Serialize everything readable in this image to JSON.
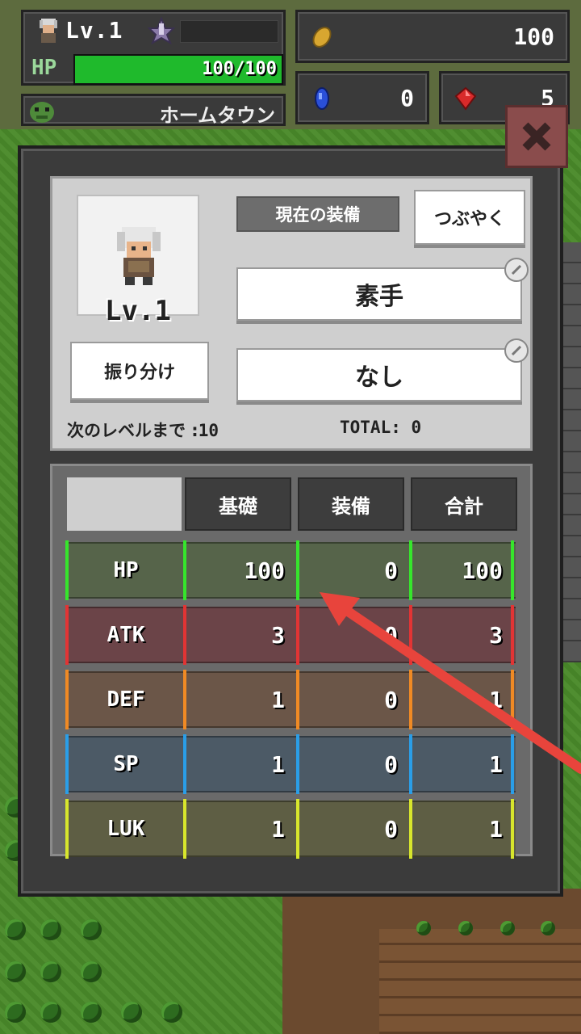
{
  "hud": {
    "level": "Lv.1",
    "hp_label": "HP",
    "hp_text": "100/100",
    "hp_fraction": 1.0,
    "location": "ホームタウン",
    "gold": "100",
    "blue_gems": "0",
    "red_gems": "5"
  },
  "dialog": {
    "portrait_level": "Lv.1",
    "current_equipment_label": "現在の装備",
    "whisper_button": "つぶやく",
    "weapon": "素手",
    "armor": "なし",
    "allocate_button": "振り分け",
    "next_level_label": "次のレベルまで :",
    "next_level_value": "10",
    "total_label": "TOTAL: ",
    "total_value": "0"
  },
  "stats": {
    "headers": [
      "基礎",
      "装備",
      "合計"
    ],
    "rows": [
      {
        "name": "HP",
        "base": "100",
        "equip": "0",
        "total": "100",
        "color": "#56644a",
        "accent": "#36e62c"
      },
      {
        "name": "ATK",
        "base": "3",
        "equip": "0",
        "total": "3",
        "color": "#6b4448",
        "accent": "#e23434"
      },
      {
        "name": "DEF",
        "base": "1",
        "equip": "0",
        "total": "1",
        "color": "#6b5648",
        "accent": "#f08a24"
      },
      {
        "name": "SP",
        "base": "1",
        "equip": "0",
        "total": "1",
        "color": "#4c5a66",
        "accent": "#2a9ee8"
      },
      {
        "name": "LUK",
        "base": "1",
        "equip": "0",
        "total": "1",
        "color": "#5e5e44",
        "accent": "#d8e62c"
      }
    ]
  },
  "colors": {
    "annotation_arrow": "#e8443c"
  }
}
